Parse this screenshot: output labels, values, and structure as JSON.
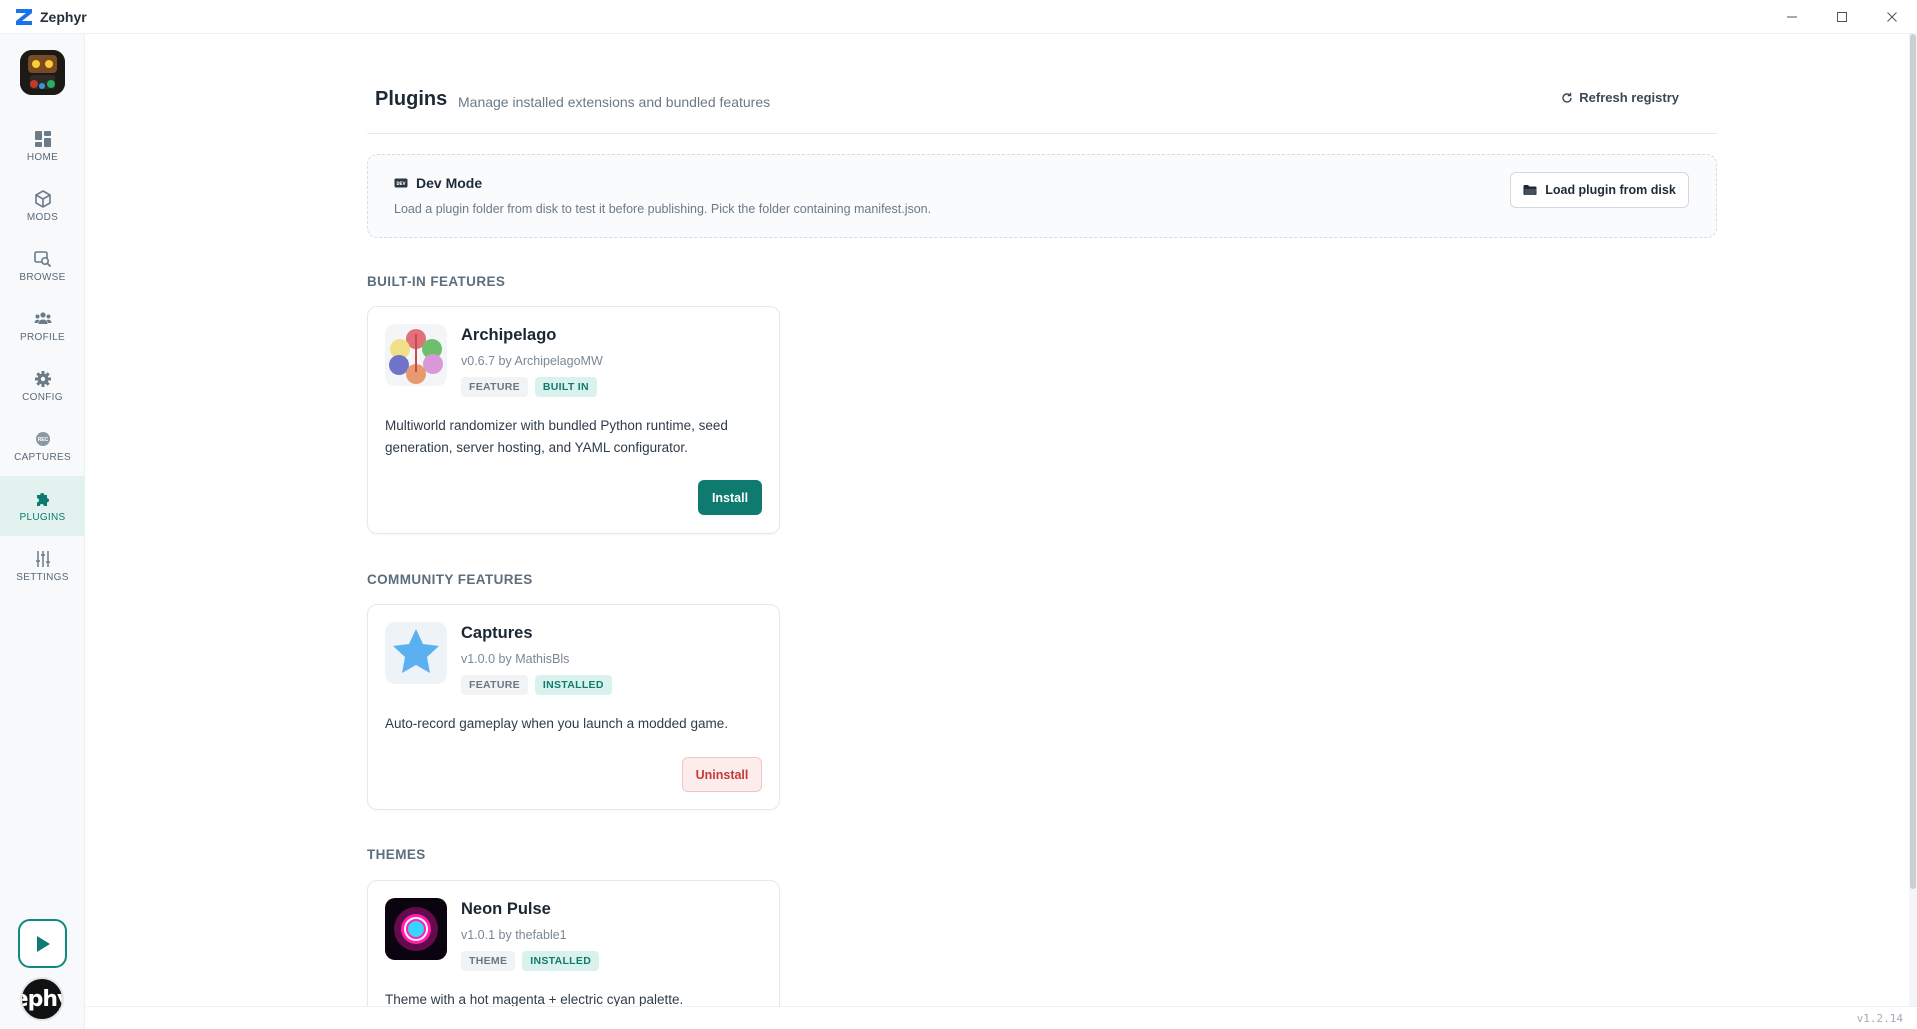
{
  "app": {
    "title": "Zephyr",
    "brand_color": "#1a73e8",
    "accent": "#0e7a70"
  },
  "window_controls": [
    "minimize-icon",
    "maximize-icon",
    "close-icon"
  ],
  "sidebar": {
    "items": [
      {
        "label": "HOME",
        "icon": "home-grid-icon"
      },
      {
        "label": "MODS",
        "icon": "cube-icon"
      },
      {
        "label": "BROWSE",
        "icon": "browse-search-icon"
      },
      {
        "label": "PROFILE",
        "icon": "users-icon"
      },
      {
        "label": "CONFIG",
        "icon": "gear-icon"
      },
      {
        "label": "CAPTURES",
        "icon": "record-icon"
      },
      {
        "label": "PLUGINS",
        "icon": "puzzle-icon",
        "active": true
      },
      {
        "label": "SETTINGS",
        "icon": "sliders-icon"
      }
    ],
    "bottom_avatar_text": "ephy"
  },
  "header": {
    "title": "Plugins",
    "subtitle": "Manage installed extensions and bundled features",
    "refresh_label": "Refresh registry"
  },
  "devmode": {
    "title": "Dev Mode",
    "description": "Load a plugin folder from disk to test it before publishing. Pick the folder containing manifest.json.",
    "button_label": "Load plugin from disk"
  },
  "sections": {
    "builtin": "BUILT-IN FEATURES",
    "community": "COMMUNITY FEATURES",
    "themes": "THEMES"
  },
  "plugins": {
    "archipelago": {
      "name": "Archipelago",
      "version": "v0.6.7 by ArchipelagoMW",
      "badges": [
        "FEATURE",
        "BUILT IN"
      ],
      "description": "Multiworld randomizer with bundled Python runtime, seed generation, server hosting, and YAML configurator.",
      "action": "Install"
    },
    "captures": {
      "name": "Captures",
      "version": "v1.0.0 by MathisBls",
      "badges": [
        "FEATURE",
        "INSTALLED"
      ],
      "description": "Auto-record gameplay when you launch a modded game.",
      "action": "Uninstall"
    },
    "neon_pulse": {
      "name": "Neon Pulse",
      "version": "v1.0.1 by thefable1",
      "badges": [
        "THEME",
        "INSTALLED"
      ],
      "description": "Theme with a hot magenta + electric cyan palette."
    }
  },
  "footer": {
    "version": "v1.2.14"
  }
}
